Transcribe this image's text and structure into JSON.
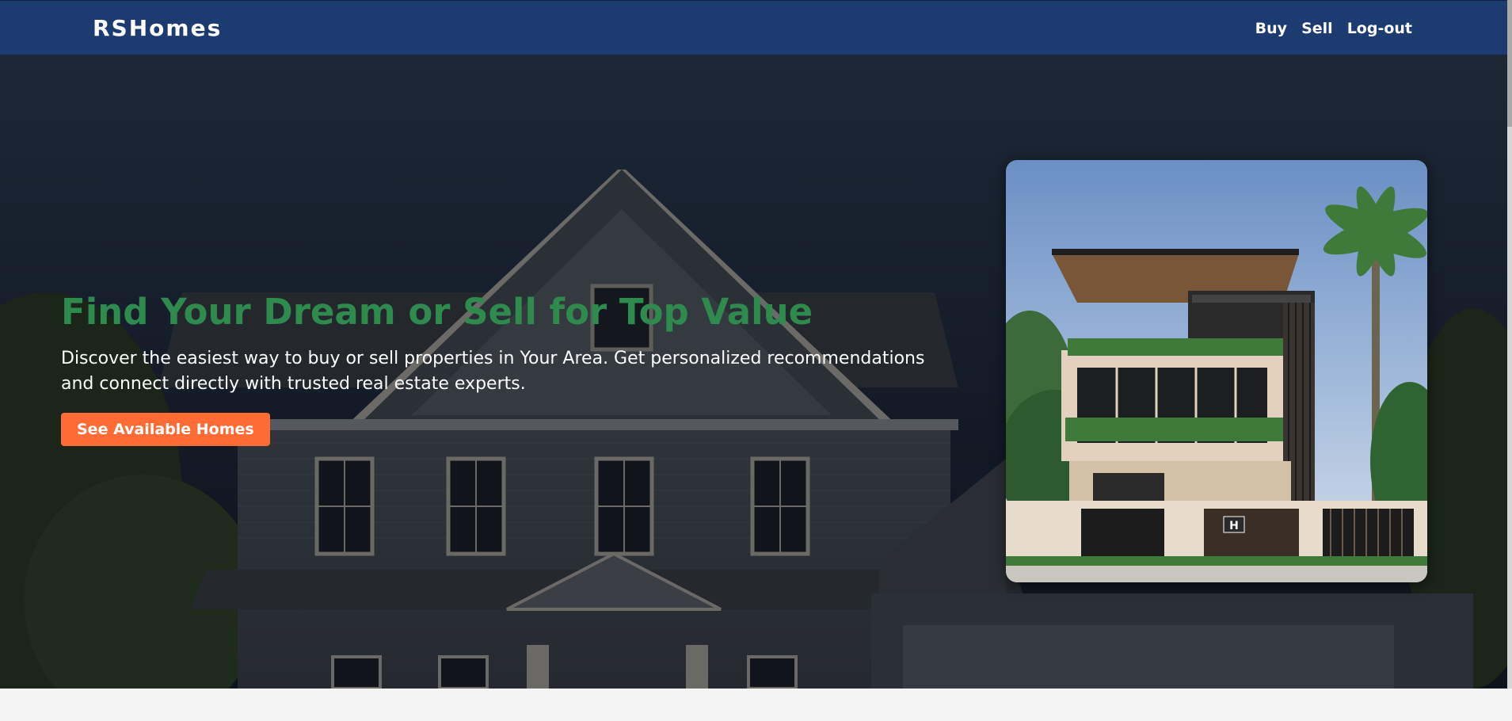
{
  "navbar": {
    "brand": "RSHomes",
    "links": [
      {
        "label": "Buy"
      },
      {
        "label": "Sell"
      },
      {
        "label": "Log-out"
      }
    ]
  },
  "hero": {
    "title": "Find Your Dream or Sell for Top Value",
    "subtitle": "Discover the easiest way to buy or sell properties in Your Area. Get personalized recommendations and connect directly with trusted real estate experts.",
    "cta_label": "See Available Homes"
  },
  "colors": {
    "navbar": "#1c3b71",
    "title": "#2f8a4e",
    "cta": "#ff6b35"
  }
}
